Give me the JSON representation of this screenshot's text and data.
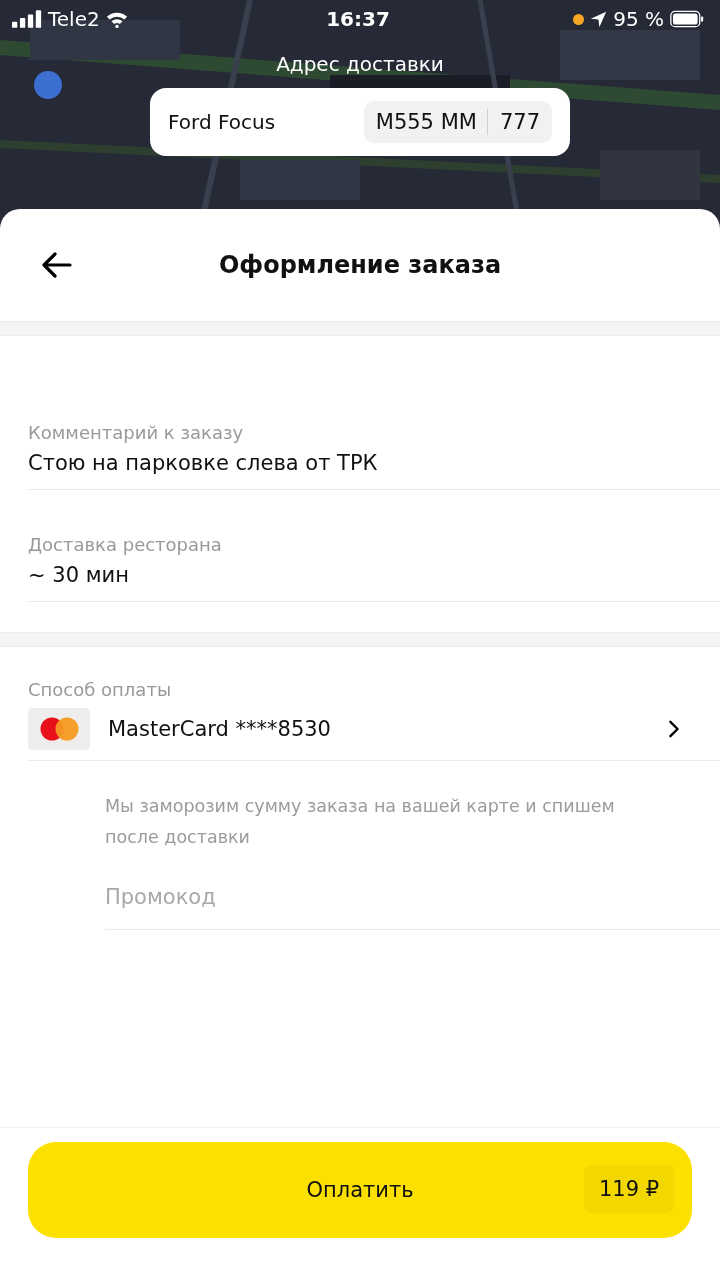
{
  "status_bar": {
    "carrier": "Tele2",
    "time": "16:37",
    "battery": "95 %"
  },
  "delivery_title": "Адрес доставки",
  "car": {
    "model": "Ford Focus",
    "plate_number": "М555 ММ",
    "plate_region": "777"
  },
  "header": {
    "title": "Оформление заказа"
  },
  "fields": [
    {
      "label": "Комментарий к заказу",
      "value": "Стою на парковке слева от ТРК"
    },
    {
      "label": "Доставка ресторана",
      "value": "~ 30 мин"
    }
  ],
  "payment": {
    "label": "Способ оплаты",
    "card": "MasterCard ****8530",
    "note": "Мы заморозим сумму заказа на вашей карте и спишем после доставки",
    "promo_placeholder": "Промокод"
  },
  "pay_button": {
    "label": "Оплатить",
    "amount": "119 ₽"
  }
}
